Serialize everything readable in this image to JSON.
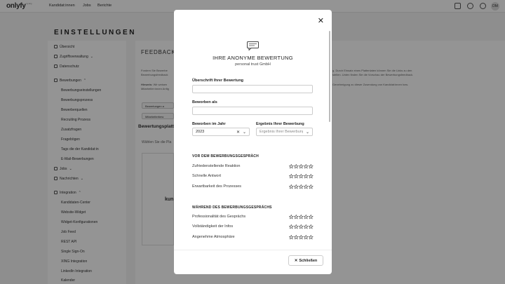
{
  "header": {
    "logo": "onlyfy",
    "logo_sub": "by xing",
    "nav": [
      "Kandidat:innen",
      "Jobs",
      "Berichte"
    ],
    "avatar_initials": "DM"
  },
  "sidebar": {
    "title": "EINSTELLUNGEN",
    "items": [
      {
        "label": "Übersicht"
      },
      {
        "label": "Zugriffsverwaltung"
      },
      {
        "label": "Datenschutz"
      },
      {
        "label": "Bewerbungen"
      },
      {
        "label": "Bewerbungseinstellungen"
      },
      {
        "label": "Bewerbungsprozess"
      },
      {
        "label": "Bewerberquellen"
      },
      {
        "label": "Recruiting Prozess"
      },
      {
        "label": "Zusatzfragen"
      },
      {
        "label": "Fragebögen"
      },
      {
        "label": "Tags die der Kandidat:in"
      },
      {
        "label": "E-Mail-Bewerbungen"
      },
      {
        "label": "Jobs"
      },
      {
        "label": "Nachrichten"
      },
      {
        "label": "Integration"
      },
      {
        "label": "Kandidaten-Center"
      },
      {
        "label": "Website-Widget"
      },
      {
        "label": "Widget-Konfigurationen"
      },
      {
        "label": "Job Feed"
      },
      {
        "label": "REST API"
      },
      {
        "label": "Single Sign-On"
      },
      {
        "label": "XING Integration"
      },
      {
        "label": "LinkedIn Integration"
      },
      {
        "label": "Kalender"
      }
    ]
  },
  "background": {
    "section_title": "FEEDBACK",
    "text1": "Fordern Sie Bewerbe",
    "text1b": "Bewerbungsfeedback",
    "text1r": "g. Durch Einsatz eines Plattenlaten können Sie die Links zu den",
    "text1r2": "stellen. Unten finden Sie die Vorschau der Bewerbungsfeedback.",
    "hint_label": "Hinweis:",
    "hint_text": "Wir weisen",
    "hint_text2": "Mitarbeiter:innen Anfig",
    "hint_right": "Genehmigung zu dieser Zusendung von Kandidat:innen bzw.",
    "btn1": "Bewertungen a",
    "btn2": "Mitarbeiterbew",
    "sub_title": "Bewertungsplattf",
    "choose_text": "Wählen Sie die Pla",
    "platform_logo": "kun"
  },
  "modal": {
    "title": "IHRE ANONYME BEWERTUNG",
    "subtitle": "personal trust GmbH",
    "fields": {
      "review_title_label": "Überschrift Ihrer Bewertung",
      "review_title_value": "",
      "applied_as_label": "Beworben als",
      "applied_as_value": "",
      "year_label": "Beworben im Jahr",
      "year_value": "2023",
      "result_label": "Ergebnis Ihrer Bewerbung",
      "result_placeholder": "Ergebnis Ihrer Bewerbung"
    },
    "sections": [
      {
        "title": "VOR DEM BEWERBUNGSGESPRÄCH",
        "ratings": [
          {
            "label": "Zufriedenstellende Reaktion",
            "stars": 0,
            "max": 5
          },
          {
            "label": "Schnelle Antwort",
            "stars": 0,
            "max": 5
          },
          {
            "label": "Erwartbarkeit des Prozesses",
            "stars": 0,
            "max": 5
          }
        ]
      },
      {
        "title": "WÄHREND DES BEWERBUNGSGESPRÄCHS",
        "ratings": [
          {
            "label": "Professionalität des Gesprächs",
            "stars": 0,
            "max": 5
          },
          {
            "label": "Vollständigkeit der Infos",
            "stars": 0,
            "max": 5
          },
          {
            "label": "Angenehme Atmosphäre",
            "stars": 0,
            "max": 5
          }
        ]
      }
    ],
    "close_label": "Schließen"
  }
}
